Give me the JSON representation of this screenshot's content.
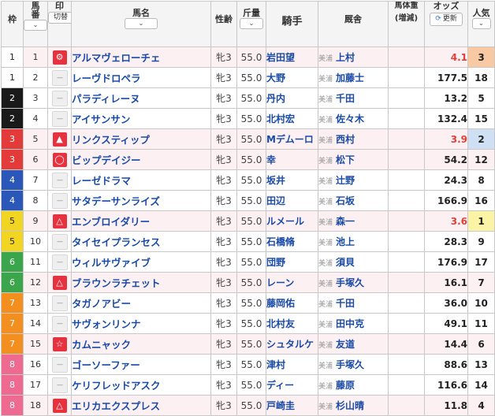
{
  "headers": {
    "waku": "枠",
    "umaban_line1": "馬",
    "umaban_line2": "番",
    "mark": "印",
    "mark_toggle": "切替",
    "horse": "馬名",
    "sexage": "性齢",
    "weight_carried": "斤量",
    "jockey": "騎手",
    "trainer": "厩舎",
    "body_weight_line1": "馬体重",
    "body_weight_line2": "(増減)",
    "odds": "オッズ",
    "refresh": "更新",
    "popularity": "人気"
  },
  "stable_label": "美浦",
  "waku_colors": {
    "1": "#ffffff",
    "2": "#1a1a1a",
    "3": "#e33a3a",
    "4": "#2a57b8",
    "5": "#f2d422",
    "6": "#3aa54a",
    "7": "#f28f1f",
    "8": "#ee6a90"
  },
  "horses": [
    {
      "waku": "1",
      "umaban": "1",
      "mark": "gear",
      "name": "アルマヴェローチェ",
      "sexage": "牝3",
      "kin": "55.0",
      "jockey": "岩田望",
      "trainer": "上村",
      "odds": "4.1",
      "pop": "3"
    },
    {
      "waku": "1",
      "umaban": "2",
      "mark": "none",
      "name": "レーヴドロペラ",
      "sexage": "牝3",
      "kin": "55.0",
      "jockey": "大野",
      "trainer": "加藤士",
      "odds": "177.5",
      "pop": "18"
    },
    {
      "waku": "2",
      "umaban": "3",
      "mark": "none",
      "name": "パラディレーヌ",
      "sexage": "牝3",
      "kin": "55.0",
      "jockey": "丹内",
      "trainer": "千田",
      "odds": "13.2",
      "pop": "5"
    },
    {
      "waku": "2",
      "umaban": "4",
      "mark": "none",
      "name": "アイサンサン",
      "sexage": "牝3",
      "kin": "55.0",
      "jockey": "北村宏",
      "trainer": "佐々木",
      "odds": "132.4",
      "pop": "15"
    },
    {
      "waku": "3",
      "umaban": "5",
      "mark": "triangle-filled",
      "name": "リンクスティップ",
      "sexage": "牝3",
      "kin": "55.0",
      "jockey": "Mデムーロ",
      "trainer": "西村",
      "odds": "3.9",
      "pop": "2"
    },
    {
      "waku": "3",
      "umaban": "6",
      "mark": "circle",
      "name": "ビップデイジー",
      "sexage": "牝3",
      "kin": "55.0",
      "jockey": "幸",
      "trainer": "松下",
      "odds": "54.2",
      "pop": "12"
    },
    {
      "waku": "4",
      "umaban": "7",
      "mark": "none",
      "name": "レーゼドラマ",
      "sexage": "牝3",
      "kin": "55.0",
      "jockey": "坂井",
      "trainer": "辻野",
      "odds": "24.3",
      "pop": "8"
    },
    {
      "waku": "4",
      "umaban": "8",
      "mark": "none",
      "name": "サタデーサンライズ",
      "sexage": "牝3",
      "kin": "55.0",
      "jockey": "田辺",
      "trainer": "石坂",
      "odds": "166.9",
      "pop": "16"
    },
    {
      "waku": "5",
      "umaban": "9",
      "mark": "triangle",
      "name": "エンブロイダリー",
      "sexage": "牝3",
      "kin": "55.0",
      "jockey": "ルメール",
      "trainer": "森一",
      "odds": "3.6",
      "pop": "1"
    },
    {
      "waku": "5",
      "umaban": "10",
      "mark": "none",
      "name": "タイセイプランセス",
      "sexage": "牝3",
      "kin": "55.0",
      "jockey": "石橋脩",
      "trainer": "池上",
      "odds": "28.3",
      "pop": "9"
    },
    {
      "waku": "6",
      "umaban": "11",
      "mark": "none",
      "name": "ウィルサヴァイブ",
      "sexage": "牝3",
      "kin": "55.0",
      "jockey": "団野",
      "trainer": "須貝",
      "odds": "176.9",
      "pop": "17"
    },
    {
      "waku": "6",
      "umaban": "12",
      "mark": "triangle",
      "name": "ブラウンラチェット",
      "sexage": "牝3",
      "kin": "55.0",
      "jockey": "レーン",
      "trainer": "手塚久",
      "odds": "16.1",
      "pop": "7"
    },
    {
      "waku": "7",
      "umaban": "13",
      "mark": "none",
      "name": "タガノアビー",
      "sexage": "牝3",
      "kin": "55.0",
      "jockey": "藤岡佑",
      "trainer": "千田",
      "odds": "36.0",
      "pop": "10"
    },
    {
      "waku": "7",
      "umaban": "14",
      "mark": "none",
      "name": "サヴォンリンナ",
      "sexage": "牝3",
      "kin": "55.0",
      "jockey": "北村友",
      "trainer": "田中克",
      "odds": "49.1",
      "pop": "11"
    },
    {
      "waku": "7",
      "umaban": "15",
      "mark": "star",
      "name": "カムニャック",
      "sexage": "牝3",
      "kin": "55.0",
      "jockey": "シュタルケ",
      "trainer": "友道",
      "odds": "14.4",
      "pop": "6"
    },
    {
      "waku": "8",
      "umaban": "16",
      "mark": "none",
      "name": "ゴーソーファー",
      "sexage": "牝3",
      "kin": "55.0",
      "jockey": "津村",
      "trainer": "手塚久",
      "odds": "88.6",
      "pop": "13"
    },
    {
      "waku": "8",
      "umaban": "17",
      "mark": "none",
      "name": "ケリフレッドアスク",
      "sexage": "牝3",
      "kin": "55.0",
      "jockey": "ディー",
      "trainer": "藤原",
      "odds": "116.6",
      "pop": "14"
    },
    {
      "waku": "8",
      "umaban": "18",
      "mark": "triangle",
      "name": "エリカエクスプレス",
      "sexage": "牝3",
      "kin": "55.0",
      "jockey": "戸崎圭",
      "trainer": "杉山晴",
      "odds": "11.8",
      "pop": "4"
    }
  ],
  "popularity_colors": {
    "1": "#fbf3a6",
    "2": "#cfe0f4",
    "3": "#f8c9a2"
  },
  "hot_odds_color": "#e0403a"
}
